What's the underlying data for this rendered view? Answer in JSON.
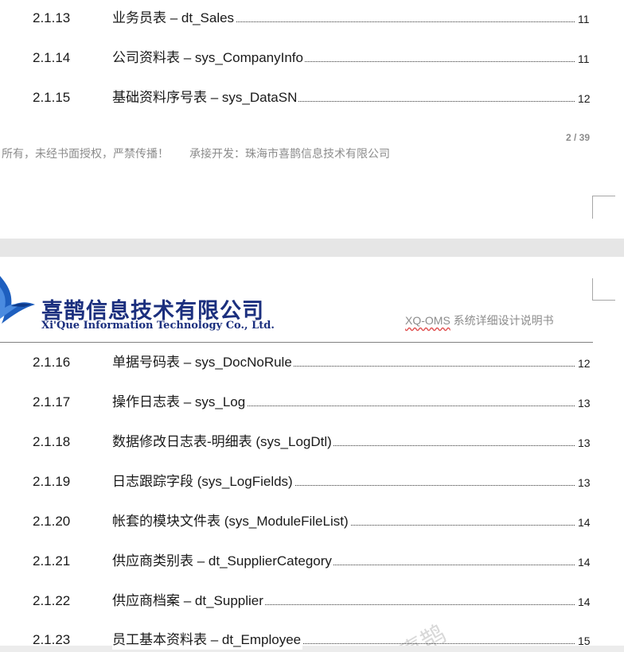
{
  "top_page": {
    "toc": [
      {
        "num": "2.1.13",
        "title": "业务员表 – dt_Sales",
        "page": "11"
      },
      {
        "num": "2.1.14",
        "title": "公司资料表 – sys_CompanyInfo",
        "page": "11"
      },
      {
        "num": "2.1.15",
        "title": "基础资料序号表 – sys_DataSN",
        "page": "12"
      }
    ],
    "footer": {
      "copyright": "所有，未经书面授权，严禁传播！",
      "developer": "承接开发：珠海市喜鹊信息技术有限公司"
    },
    "page_count": "2 / 39"
  },
  "bottom_page": {
    "header": {
      "company_cn": "喜鹊信息技术有限公司",
      "company_en": "Xi'Que Information Technology Co., Ltd.",
      "doc_code": "XQ-OMS",
      "doc_title": " 系统详细设计说明书"
    },
    "toc": [
      {
        "num": "2.1.16",
        "title": "单据号码表 – sys_DocNoRule",
        "page": "12"
      },
      {
        "num": "2.1.17",
        "title": "操作日志表 – sys_Log",
        "page": "13"
      },
      {
        "num": "2.1.18",
        "title": "数据修改日志表-明细表 (sys_LogDtl)",
        "page": "13"
      },
      {
        "num": "2.1.19",
        "title": "日志跟踪字段 (sys_LogFields)",
        "page": "13"
      },
      {
        "num": "2.1.20",
        "title": "帐套的模块文件表 (sys_ModuleFileList)",
        "page": "14"
      },
      {
        "num": "2.1.21",
        "title": "供应商类别表 – dt_SupplierCategory",
        "page": "14"
      },
      {
        "num": "2.1.22",
        "title": "供应商档案 – dt_Supplier",
        "page": "14"
      },
      {
        "num": "2.1.23",
        "title": "员工基本资料表 – dt_Employee",
        "page": "15"
      }
    ],
    "watermark": "喜鹊"
  },
  "colors": {
    "logo_blue": "#1b2f7e",
    "footer_gray": "#8c8c8c",
    "page_bg": "#ffffff",
    "gap_bg": "#e6e6e6"
  }
}
